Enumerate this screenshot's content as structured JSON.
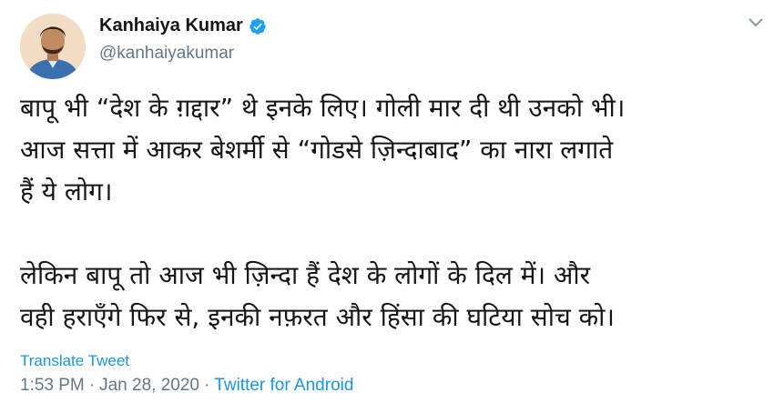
{
  "author": {
    "display_name": "Kanhaiya Kumar",
    "handle": "@kanhaiyakumar",
    "verified_icon": "verified-badge-icon"
  },
  "tweet": {
    "lines": [
      "बापू भी “देश के ग़द्दार” थे इनके लिए। गोली मार दी थी उनको भी।",
      "आज सत्ता में आकर बेशर्मी से “गोडसे ज़िन्दाबाद” का नारा लगाते",
      "हैं ये लोग।",
      "लेकिन बापू तो आज भी ज़िन्दा हैं देश के लोगों के दिल में। और",
      "वही हराएँगे फिर से, इनकी नफ़रत और हिंसा की घटिया सोच को।"
    ],
    "translate_label": "Translate Tweet",
    "time": "1:53 PM",
    "date": "Jan 28, 2020",
    "separator": "·",
    "source": "Twitter for Android"
  },
  "colors": {
    "link": "#1b95e0",
    "secondary_text": "#657786",
    "primary_text": "#14171a"
  }
}
